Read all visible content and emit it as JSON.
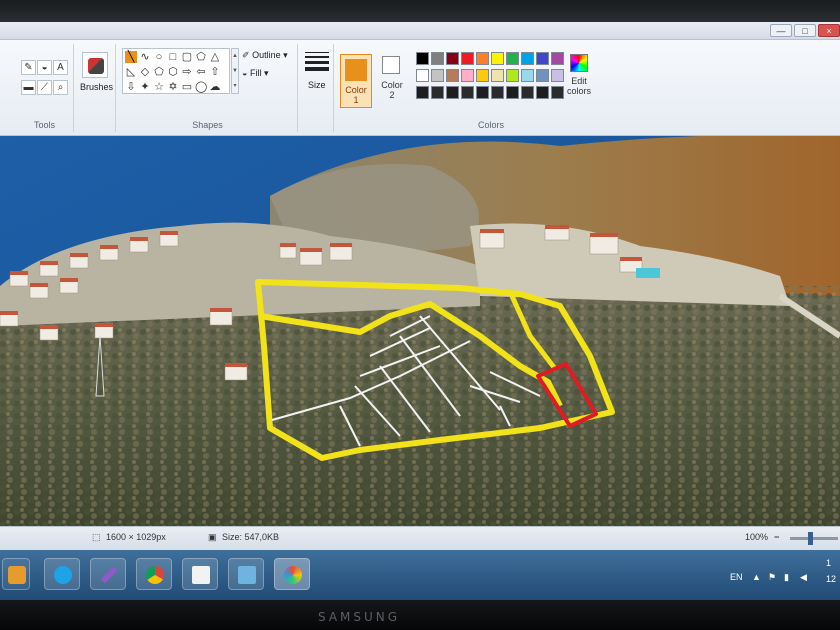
{
  "monitor": {
    "brand": "SAMSUNG"
  },
  "window": {
    "controls": {
      "minimize": "—",
      "maximize": "□",
      "close": "×"
    }
  },
  "ribbon": {
    "tools": {
      "label": "Tools"
    },
    "brushes": {
      "label": "Brushes"
    },
    "shapes": {
      "label": "Shapes",
      "outline": "Outline",
      "fill": "Fill"
    },
    "size": {
      "label": "Size"
    },
    "color1": {
      "label_line1": "Color",
      "label_line2": "1",
      "value": "#e8901c"
    },
    "color2": {
      "label_line1": "Color",
      "label_line2": "2",
      "value": "#ffffff"
    },
    "colors": {
      "label": "Colors"
    },
    "edit_colors": {
      "label_line1": "Edit",
      "label_line2": "colors"
    },
    "palette": [
      "#000000",
      "#7f7f7f",
      "#880015",
      "#ed1c24",
      "#ff7f27",
      "#fff200",
      "#22b14c",
      "#00a2e8",
      "#3f48cc",
      "#a349a4",
      "#ffffff",
      "#c3c3c3",
      "#b97a57",
      "#ffaec9",
      "#ffc90e",
      "#efe4b0",
      "#b5e61d",
      "#99d9ea",
      "#7092be",
      "#c8bfe7",
      "#1e1e1e",
      "#2b2b2b",
      "#1e1e1e",
      "#2b2b2b",
      "#1e1e1e",
      "#2b2b2b",
      "#1e1e1e",
      "#2b2b2b",
      "#1e1e1e",
      "#2b2b2b"
    ]
  },
  "status": {
    "dimensions": "1600 × 1029px",
    "size": "Size: 547,0KB",
    "zoom": "100%"
  },
  "tray": {
    "language": "EN",
    "time": "1",
    "date": "12"
  }
}
